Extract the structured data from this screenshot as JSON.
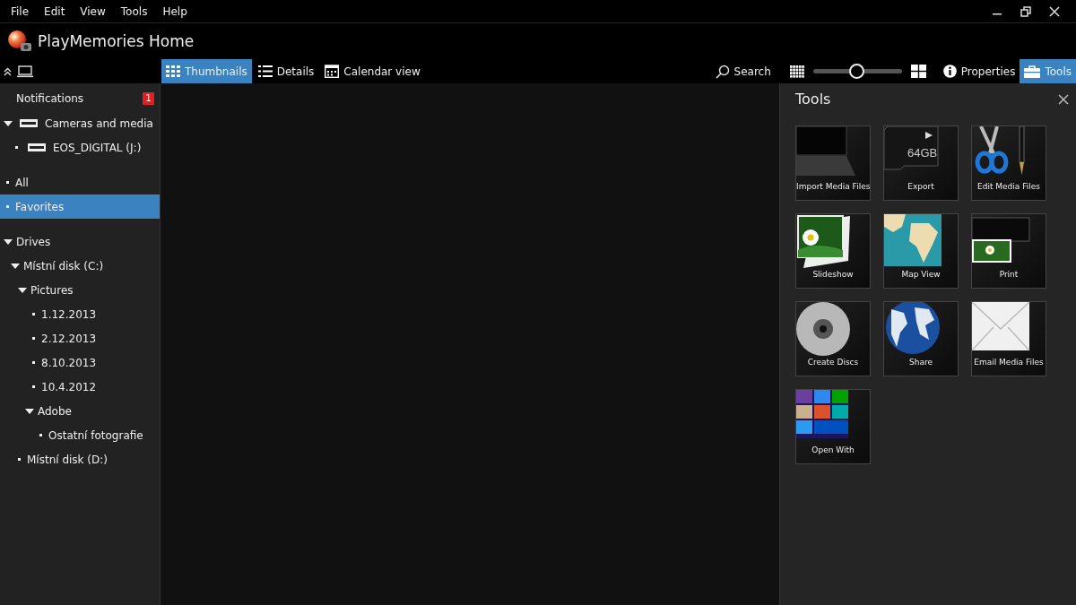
{
  "menu": [
    "File",
    "Edit",
    "View",
    "Tools",
    "Help"
  ],
  "app_title": "PlayMemories Home",
  "view_tabs": [
    {
      "label": "Thumbnails",
      "kind": "thumbnails",
      "selected": true
    },
    {
      "label": "Details",
      "kind": "details",
      "selected": false
    },
    {
      "label": "Calendar view",
      "kind": "calendar",
      "selected": false
    }
  ],
  "search": {
    "label": "Search"
  },
  "zoom_slider": {
    "level": 0.5
  },
  "panel_tabs": [
    {
      "label": "Properties",
      "kind": "info",
      "selected": false
    },
    {
      "label": "Tools",
      "kind": "toolbox",
      "selected": true
    }
  ],
  "sidebar": {
    "notifications": {
      "label": "Notifications",
      "count": "1"
    },
    "cameras": [
      {
        "label": "Cameras and media",
        "kind": "drive",
        "expanded": true,
        "children": [
          {
            "label": "EOS_DIGITAL (J:)",
            "kind": "drive"
          }
        ]
      }
    ],
    "library": [
      {
        "label": "All",
        "selected": false
      },
      {
        "label": "Favorites",
        "selected": true
      }
    ],
    "drives": [
      {
        "label": "Drives",
        "expanded": true,
        "children": [
          {
            "label": "Místní disk (C:)",
            "expanded": true,
            "children": [
              {
                "label": "Pictures",
                "expanded": true,
                "children": [
                  {
                    "label": "1.12.2013"
                  },
                  {
                    "label": "2.12.2013"
                  },
                  {
                    "label": "8.10.2013"
                  },
                  {
                    "label": "10.4.2012"
                  },
                  {
                    "label": "Adobe",
                    "expanded": true,
                    "children": [
                      {
                        "label": "Ostatní fotografie"
                      }
                    ]
                  }
                ]
              }
            ]
          },
          {
            "label": "Místní disk (D:)"
          }
        ]
      }
    ]
  },
  "tools_panel": {
    "title": "Tools",
    "tools": [
      {
        "label": "Import Media Files",
        "kind": "laptop"
      },
      {
        "label": "Export",
        "kind": "sdcard",
        "icon_text": "64GB"
      },
      {
        "label": "Edit Media Files",
        "kind": "scissors"
      },
      {
        "label": "Slideshow",
        "kind": "photos"
      },
      {
        "label": "Map View",
        "kind": "map"
      },
      {
        "label": "Print",
        "kind": "printer"
      },
      {
        "label": "Create Discs",
        "kind": "disc"
      },
      {
        "label": "Share",
        "kind": "globe"
      },
      {
        "label": "Email Media Files",
        "kind": "envelope"
      },
      {
        "label": "Open With",
        "kind": "tiles"
      }
    ]
  }
}
